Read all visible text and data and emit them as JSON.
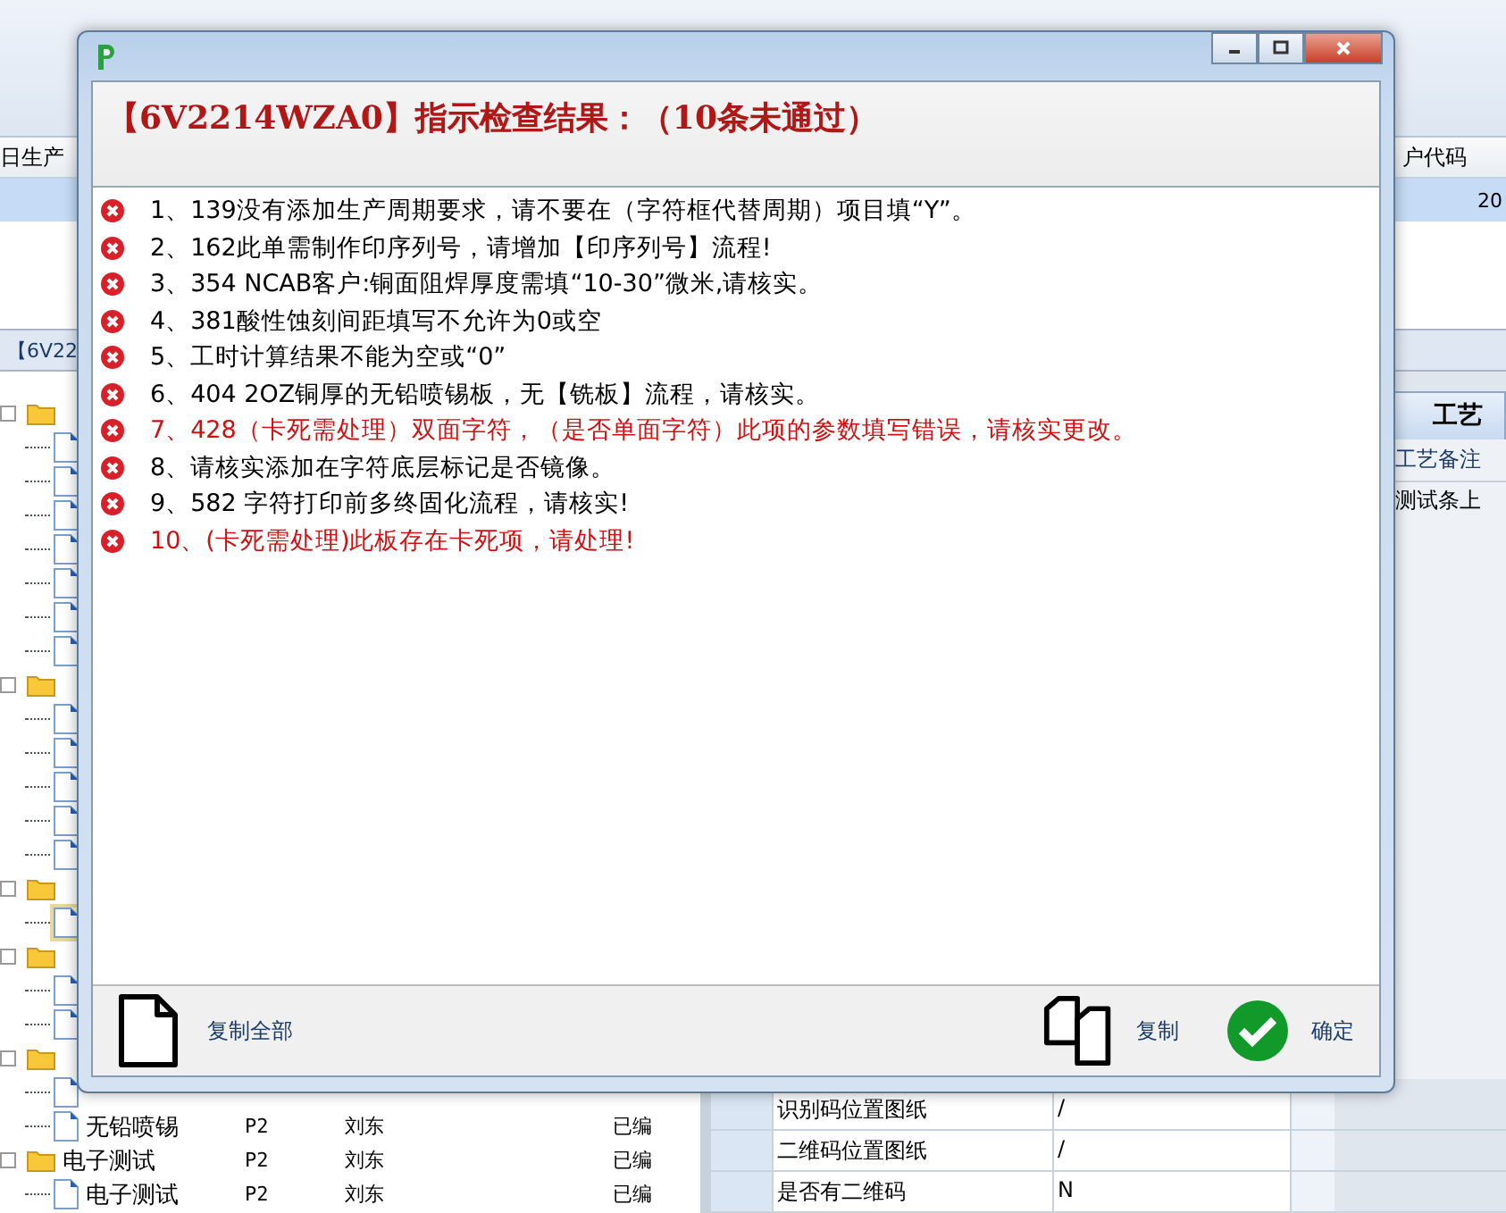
{
  "background": {
    "header_columns": [
      "日生产",
      "户代码"
    ],
    "selected_row_value": "20",
    "tab_label": "【6V22",
    "tree": [
      {
        "children": [
          {
            "selected": false
          },
          {
            "selected": false
          },
          {
            "selected": false
          },
          {
            "selected": false
          },
          {
            "selected": false
          },
          {
            "selected": false
          },
          {
            "selected": false
          }
        ]
      },
      {
        "children": [
          {
            "selected": false
          },
          {
            "selected": false
          },
          {
            "selected": false
          },
          {
            "selected": false
          },
          {
            "selected": false
          }
        ]
      },
      {
        "children": [
          {
            "selected": true
          }
        ]
      },
      {
        "children": [
          {
            "selected": false
          },
          {
            "selected": false
          }
        ]
      },
      {
        "children": [
          {
            "selected": false
          },
          {
            "label": "无铅喷锡",
            "cells": [
              "P2",
              "刘东",
              "已编"
            ],
            "selected": false
          }
        ]
      },
      {
        "label": "电子测试",
        "cells": [
          "P2",
          "刘东",
          "已编"
        ],
        "children": [
          {
            "label": "电子测试",
            "cells": [
              "P2",
              "刘东",
              "已编"
            ],
            "selected": false
          }
        ]
      }
    ],
    "side_tab": "工艺",
    "notes_header": "工艺备注",
    "notes_text": "测试条上",
    "grid": [
      {
        "name": "识别码位置图纸",
        "value": "/"
      },
      {
        "name": "二维码位置图纸",
        "value": "/"
      },
      {
        "name": "是否有二维码",
        "value": "N"
      }
    ]
  },
  "dialog": {
    "title": "【6V2214WZA0】指示检查结果：（10条未通过）",
    "items": [
      {
        "text": "1、139没有添加生产周期要求，请不要在（字符框代替周期）项目填“Y”。",
        "color": "#000000"
      },
      {
        "text": "2、162此单需制作印序列号，请增加【印序列号】流程!",
        "color": "#000000"
      },
      {
        "text": "3、354  NCAB客户:铜面阻焊厚度需填“10-30”微米,请核实。",
        "color": "#000000"
      },
      {
        "text": "4、381酸性蚀刻间距填写不允许为0或空",
        "color": "#000000"
      },
      {
        "text": "5、工时计算结果不能为空或“0”",
        "color": "#000000"
      },
      {
        "text": "6、404  2OZ铜厚的无铅喷锡板，无【铣板】流程，请核实。",
        "color": "#000000"
      },
      {
        "text": "7、428（卡死需处理）双面字符，（是否单面字符）此项的参数填写错误，请核实更改。",
        "color": "#d01010"
      },
      {
        "text": "8、请核实添加在字符底层标记是否镜像。",
        "color": "#000000"
      },
      {
        "text": "9、582 字符打印前多终固化流程，请核实!",
        "color": "#000000"
      },
      {
        "text": "10、(卡死需处理)此板存在卡死项，请处理!",
        "color": "#d01010"
      }
    ],
    "buttons": [
      {
        "kind": "copy_all",
        "label": "复制全部"
      },
      {
        "kind": "copy",
        "label": "复制"
      },
      {
        "kind": "ok",
        "label": "确定"
      }
    ]
  }
}
